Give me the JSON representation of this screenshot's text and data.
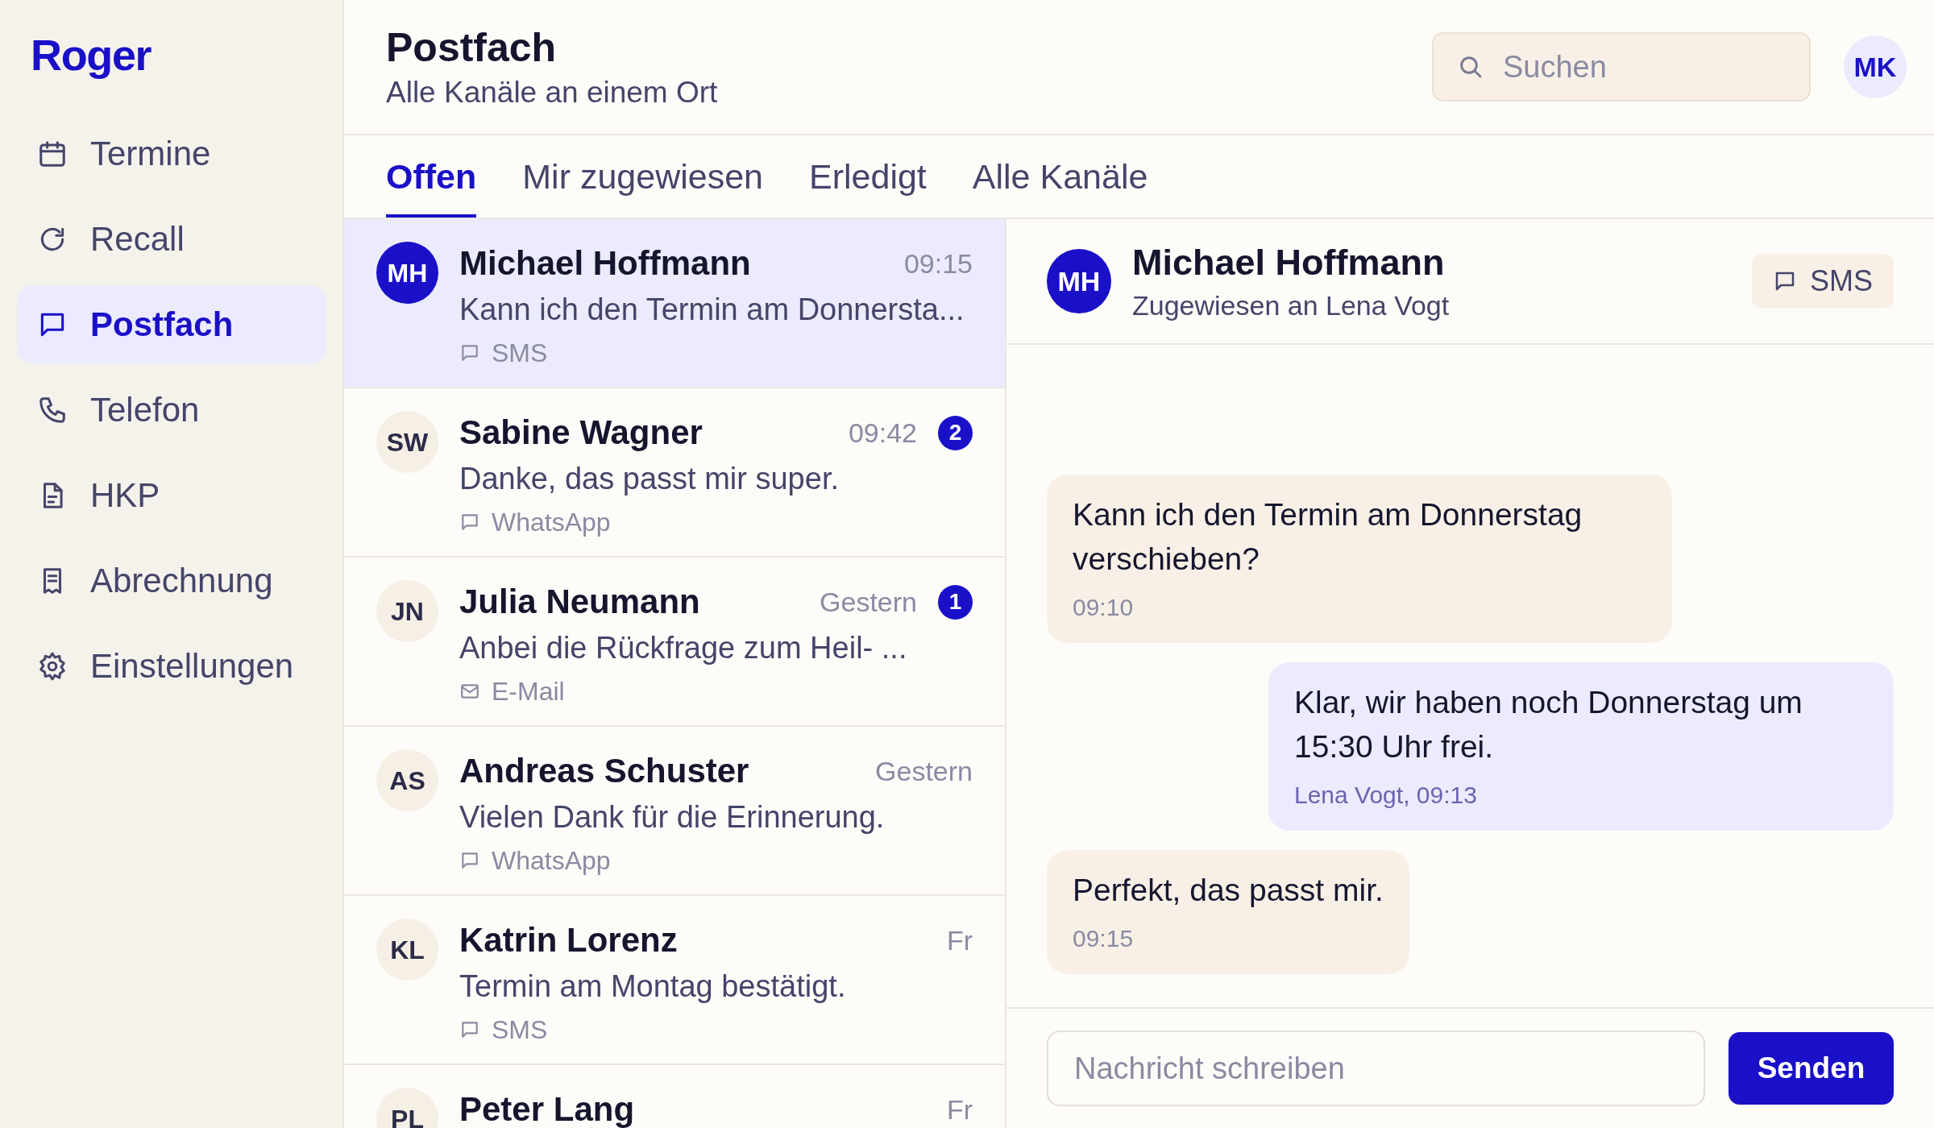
{
  "app": {
    "logo": "Roger"
  },
  "sidebar": {
    "items": [
      {
        "label": "Termine",
        "selected": false
      },
      {
        "label": "Recall",
        "selected": false
      },
      {
        "label": "Postfach",
        "selected": true
      },
      {
        "label": "Telefon",
        "selected": false
      },
      {
        "label": "HKP",
        "selected": false
      },
      {
        "label": "Abrechnung",
        "selected": false
      },
      {
        "label": "Einstellungen",
        "selected": false
      }
    ]
  },
  "header": {
    "title": "Postfach",
    "subtitle": "Alle Kanäle an einem Ort"
  },
  "search": {
    "placeholder": "Suchen"
  },
  "user_avatar": {
    "initials": "MK"
  },
  "tabs": [
    {
      "label": "Offen",
      "selected": true
    },
    {
      "label": "Mir zugewiesen",
      "selected": false
    },
    {
      "label": "Erledigt",
      "selected": false
    },
    {
      "label": "Alle Kanäle",
      "selected": false
    }
  ],
  "conversations": [
    {
      "initials": "MH",
      "name": "Michael Hoffmann",
      "time": "09:15",
      "preview": "Kann ich den Termin am Donnersta...",
      "kind": "message",
      "channel": "SMS",
      "selected": true
    },
    {
      "initials": "SW",
      "name": "Sabine Wagner",
      "time": "09:42",
      "unread": "2",
      "preview": "Danke, das passt mir super.",
      "kind": "message",
      "channel": "WhatsApp",
      "selected": false
    },
    {
      "initials": "JN",
      "name": "Julia Neumann",
      "time": "Gestern",
      "unread": "1",
      "preview": "Anbei die Rückfrage zum Heil- ...",
      "kind": "email",
      "channel": "E-Mail",
      "selected": false
    },
    {
      "initials": "AS",
      "name": "Andreas Schuster",
      "time": "Gestern",
      "preview": "Vielen Dank für die Erinnerung.",
      "kind": "message",
      "channel": "WhatsApp",
      "selected": false
    },
    {
      "initials": "KL",
      "name": "Katrin Lorenz",
      "time": "Fr",
      "preview": "Termin am Montag bestätigt.",
      "kind": "message",
      "channel": "SMS",
      "selected": false
    },
    {
      "initials": "PL",
      "name": "Peter Lang",
      "time": "Fr",
      "selected": false
    }
  ],
  "conversation": {
    "initials": "MH",
    "name": "Michael Hoffmann",
    "assigned": "Zugewiesen an Lena Vogt",
    "channel": "SMS",
    "messages": [
      {
        "kind": "incoming",
        "text": "Kann ich den Termin am Donnerstag verschieben?",
        "meta": "09:10"
      },
      {
        "kind": "outgoing",
        "text": "Klar, wir haben noch Donnerstag um 15:30 Uhr frei.",
        "meta": "Lena Vogt, 09:13"
      },
      {
        "kind": "incoming",
        "text": "Perfekt, das passt mir.",
        "meta": "09:15"
      }
    ]
  },
  "composer": {
    "placeholder": "Nachricht schreiben",
    "send_label": "Senden"
  }
}
